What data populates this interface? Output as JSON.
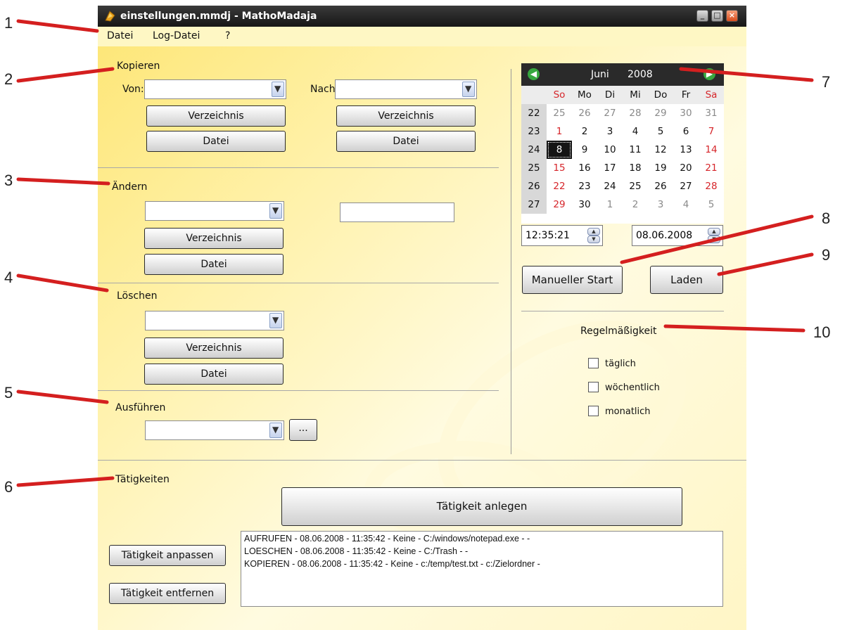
{
  "window": {
    "title": "einstellungen.mmdj - MathoMadaja",
    "minimize": "_",
    "maximize": "□",
    "close": "×"
  },
  "menu": [
    "Datei",
    "Log-Datei",
    "?"
  ],
  "callouts": [
    "1",
    "2",
    "3",
    "4",
    "5",
    "6",
    "7",
    "8",
    "9",
    "10"
  ],
  "kopieren": {
    "label": "Kopieren",
    "von_label": "Von:",
    "nach_label": "Nach:",
    "von_value": "",
    "nach_value": "",
    "von_verzeichnis": "Verzeichnis",
    "von_datei": "Datei",
    "nach_verzeichnis": "Verzeichnis",
    "nach_datei": "Datei"
  },
  "aendern": {
    "label": "Ändern",
    "combo_value": "",
    "text_value": "",
    "verzeichnis": "Verzeichnis",
    "datei": "Datei"
  },
  "loeschen": {
    "label": "Löschen",
    "combo_value": "",
    "verzeichnis": "Verzeichnis",
    "datei": "Datei"
  },
  "ausfuehren": {
    "label": "Ausführen",
    "combo_value": "",
    "browse": "..."
  },
  "calendar": {
    "month": "Juni",
    "year": "2008",
    "prev_icon": "arrow-left-icon",
    "next_icon": "arrow-right-icon",
    "dow": [
      "So",
      "Mo",
      "Di",
      "Mi",
      "Do",
      "Fr",
      "Sa"
    ],
    "weeks": [
      {
        "week": "22",
        "days": [
          "25",
          "26",
          "27",
          "28",
          "29",
          "30",
          "31"
        ]
      },
      {
        "week": "23",
        "days": [
          "1",
          "2",
          "3",
          "4",
          "5",
          "6",
          "7"
        ]
      },
      {
        "week": "24",
        "days": [
          "8",
          "9",
          "10",
          "11",
          "12",
          "13",
          "14"
        ]
      },
      {
        "week": "25",
        "days": [
          "15",
          "16",
          "17",
          "18",
          "19",
          "20",
          "21"
        ]
      },
      {
        "week": "26",
        "days": [
          "22",
          "23",
          "24",
          "25",
          "26",
          "27",
          "28"
        ]
      },
      {
        "week": "27",
        "days": [
          "29",
          "30",
          "1",
          "2",
          "3",
          "4",
          "5"
        ]
      }
    ],
    "selected": "8"
  },
  "time_value": "12:35:21",
  "date_value": "08.06.2008",
  "manual_start": "Manueller Start",
  "laden": "Laden",
  "regel": {
    "label": "Regelmäßigkeit",
    "options": [
      "täglich",
      "wöchentlich",
      "monatlich"
    ]
  },
  "taetigkeiten": {
    "label": "Tätigkeiten",
    "anlegen": "Tätigkeit anlegen",
    "anpassen": "Tätigkeit anpassen",
    "entfernen": "Tätigkeit entfernen",
    "items": [
      "AUFRUFEN - 08.06.2008 - 11:35:42 - Keine - C:/windows/notepad.exe -  -",
      "LOESCHEN - 08.06.2008 - 11:35:42 - Keine - C:/Trash -  -",
      "KOPIEREN - 08.06.2008 - 11:35:42 - Keine - c:/temp/test.txt - c:/Zielordner -"
    ]
  }
}
